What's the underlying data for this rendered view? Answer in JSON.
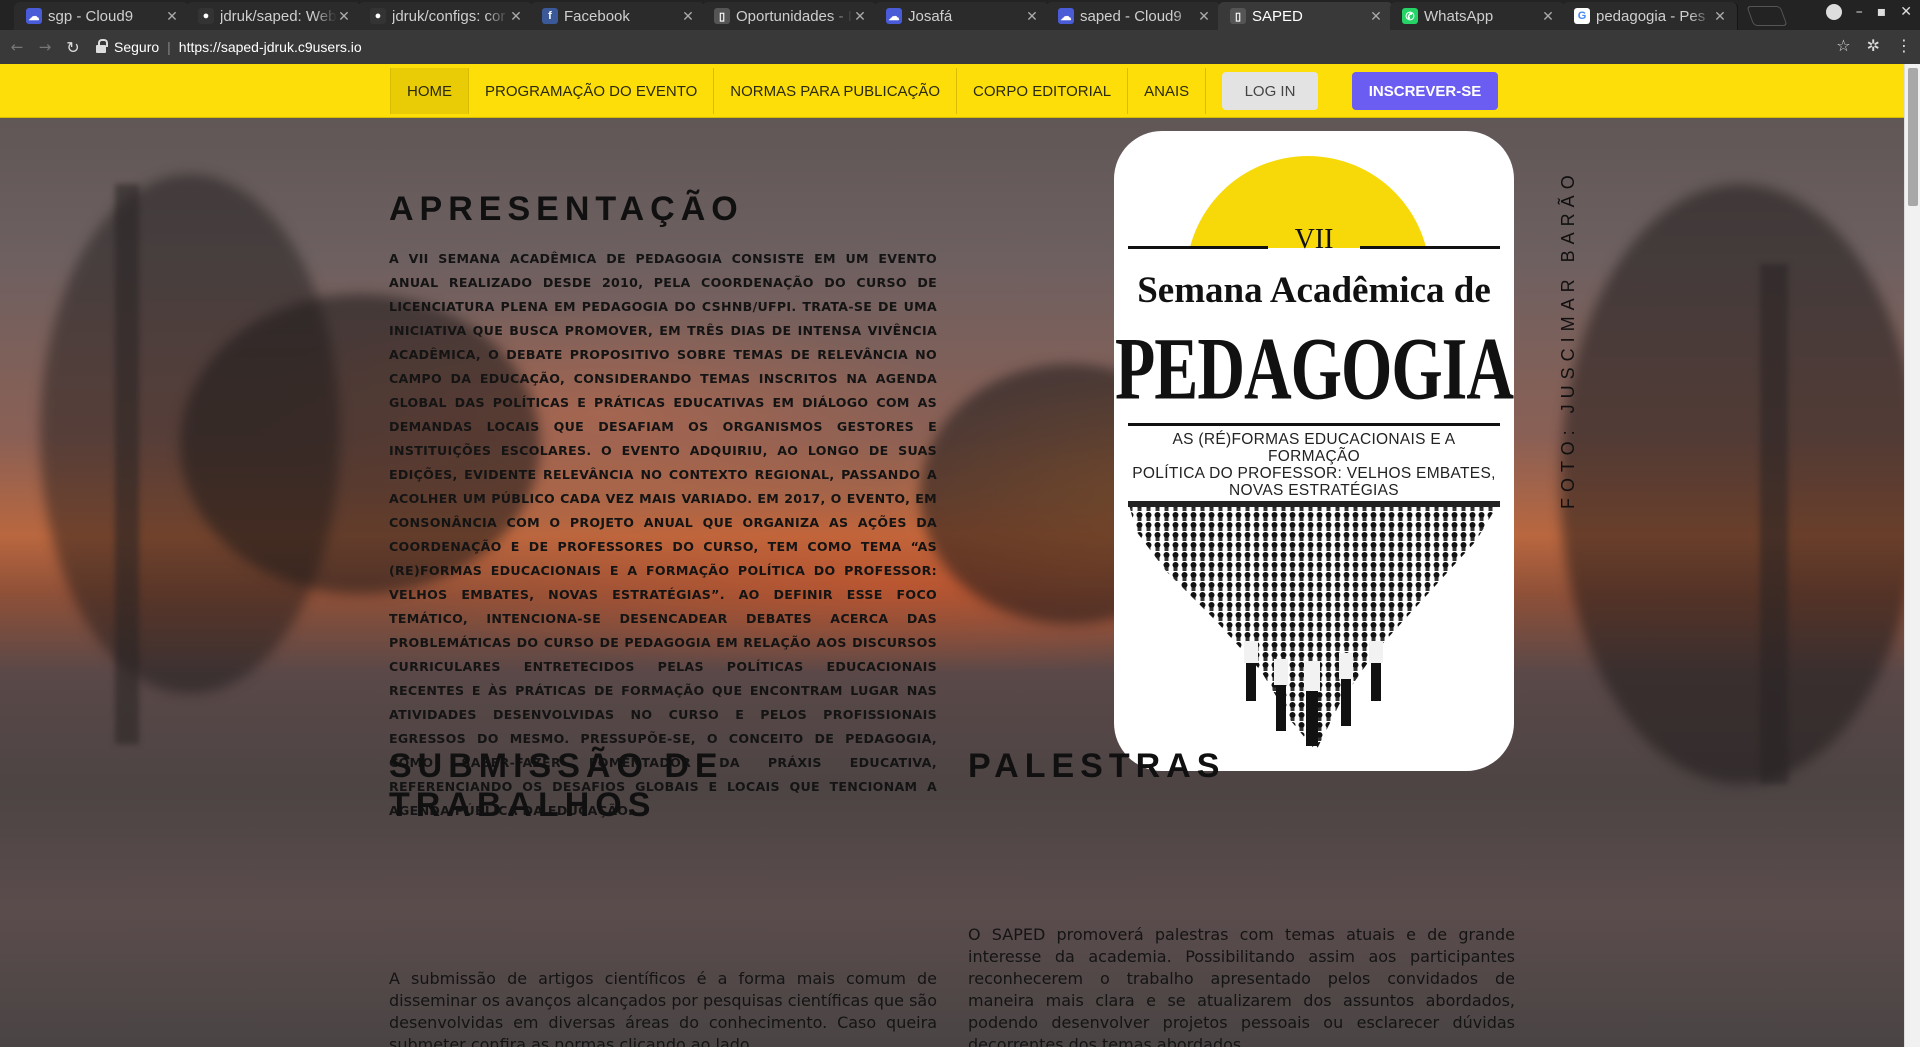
{
  "browser": {
    "tabs": [
      {
        "title": "sgp - Cloud9",
        "icon": "cloud9-icon",
        "color": "#4a5bd8"
      },
      {
        "title": "jdruk/saped: Web",
        "icon": "github-icon",
        "color": "#333333"
      },
      {
        "title": "jdruk/configs: cor",
        "icon": "github-icon",
        "color": "#333333"
      },
      {
        "title": "Facebook",
        "icon": "facebook-icon",
        "color": "#3b5998"
      },
      {
        "title": "Oportunidades - I",
        "icon": "document-icon",
        "color": "#555555"
      },
      {
        "title": "Josafá",
        "icon": "cloud9-icon",
        "color": "#4a5bd8"
      },
      {
        "title": "saped - Cloud9",
        "icon": "cloud9-icon",
        "color": "#4a5bd8"
      },
      {
        "title": "SAPED",
        "icon": "document-icon",
        "color": "#555555",
        "active": true
      },
      {
        "title": "WhatsApp",
        "icon": "whatsapp-icon",
        "color": "#25d366"
      },
      {
        "title": "pedagogia - Pes",
        "icon": "google-icon",
        "color": "#ffffff"
      }
    ],
    "security_label": "Seguro",
    "url": "https://saped-jdruk.c9users.io"
  },
  "nav": {
    "items": [
      "HOME",
      "PROGRAMAÇÃO DO EVENTO",
      "NORMAS PARA PUBLICAÇÃO",
      "CORPO EDITORIAL",
      "ANAIS"
    ],
    "active_index": 0,
    "login_label": "LOG IN",
    "signup_label": "INSCREVER-SE",
    "colors": {
      "bar": "#fdde08",
      "signup": "#6b5cf2",
      "login": "#e3e3e3"
    }
  },
  "presentation": {
    "heading": "APRESENTAÇÃO",
    "text": "A VII Semana Acadêmica de Pedagogia consiste em um evento anual realizado desde 2010, pela coordenação do curso de Licenciatura Plena em Pedagogia do CSHNB/UFPI. Trata-se de uma iniciativa que busca promover, em três dias de intensa vivência acadêmica, o debate propositivo sobre temas de relevância no campo da Educação, considerando temas inscritos na agenda global das políticas e práticas educativas em diálogo com as demandas locais que desafiam os organismos gestores e instituições escolares. O evento adquiriu, ao longo de suas edições, evidente relevância no contexto regional, passando a acolher um público cada vez mais variado. Em 2017, o evento, em consonância com o projeto anual que organiza as ações da coordenação e de professores do curso, tem como tema “As (re)formas educacionais e a formação política do professor: velhos embates, novas estratégias”. Ao definir esse foco temático, intenciona-se desencadear debates acerca das problemáticas do curso de Pedagogia em relação aos discursos curriculares entretecidos pelas políticas educacionais recentes e às práticas de formação que encontram lugar nas atividades desenvolvidas no curso e pelos profissionais egressos do mesmo. Pressupõe-se, o conceito de Pedagogia, como saber-fazer fomentador da práxis educativa, referenciando os desafios globais e locais que tencionam a agenda pública da educação."
  },
  "poster": {
    "edition": "VII",
    "subtitle": "Semana Acadêmica de",
    "title": "PEDAGOGIA",
    "theme_lines": [
      "AS (RÉ)FORMAS EDUCACIONAIS E A FORMAÇÃO",
      "POLÍTICA DO PROFESSOR: VELHOS EMBATES,",
      "NOVAS ESTRATÉGIAS"
    ],
    "sun_color": "#f7d90a"
  },
  "photo_credit": "FOTO: JUSCIMAR BARÃO",
  "submission": {
    "heading_line1": "SUBMISSÃO DE",
    "heading_line2": "TRABALHOS",
    "text": "A submissão de artigos científicos é a forma mais comum de disseminar os avanços alcançados por pesquisas científicas que são desenvolvidas em diversas áreas do conhecimento. Caso queira submeter confira as normas clicando ao lado"
  },
  "talks": {
    "heading": "PALESTRAS",
    "text": "O SAPED promoverá palestras com temas atuais e de grande interesse da academia. Possibilitando assim aos participantes reconhecerem o trabalho apresentado pelos convidados de maneira mais clara e se atualizarem dos assuntos abordados, podendo desenvolver projetos pessoais ou esclarecer dúvidas decorrentes dos temas abordados."
  }
}
